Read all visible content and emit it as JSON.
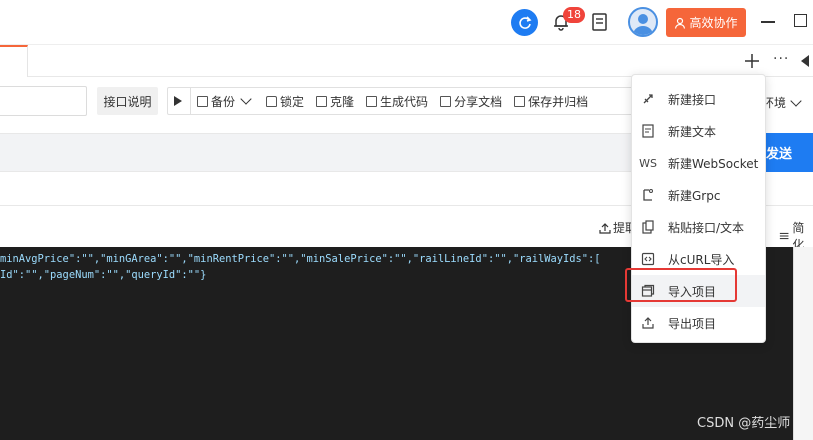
{
  "header": {
    "notification_count": "18",
    "collab_button": "高效协作"
  },
  "toolbar": {
    "doc_button": "接口说明",
    "actions": {
      "backup": "备份",
      "lock": "锁定",
      "clone": "克隆",
      "gen_code": "生成代码",
      "share_doc": "分享文档",
      "save_return": "保存并归档"
    },
    "env_label": "环境"
  },
  "send_button": "发送",
  "body_options": {
    "extract": "提取",
    "simple": "简化"
  },
  "code": {
    "line1": "minAvgPrice\":\"\",\"minGArea\":\"\",\"minRentPrice\":\"\",\"minSalePrice\":\"\",\"railLineId\":\"\",\"railWayIds\":[",
    "line2": "Id\":\"\",\"pageNum\":\"\",\"queryId\":\"\"}"
  },
  "menu": {
    "items": [
      {
        "label": "新建接口",
        "icon": "rocket-icon"
      },
      {
        "label": "新建文本",
        "icon": "document-icon"
      },
      {
        "label": "新建WebSocket",
        "icon": "ws-icon"
      },
      {
        "label": "新建Grpc",
        "icon": "grpc-icon"
      },
      {
        "label": "粘贴接口/文本",
        "icon": "paste-icon"
      },
      {
        "label": "从cURL导入",
        "icon": "code-bracket-icon"
      },
      {
        "label": "导入项目",
        "icon": "import-icon"
      },
      {
        "label": "导出项目",
        "icon": "export-icon"
      }
    ],
    "ws_glyph": "WS"
  },
  "watermark": "CSDN @药尘师",
  "colors": {
    "accent_orange": "#f5663a",
    "primary_blue": "#1e7cf2",
    "highlight_red": "#e53935",
    "editor_bg": "#1e1e1e"
  }
}
